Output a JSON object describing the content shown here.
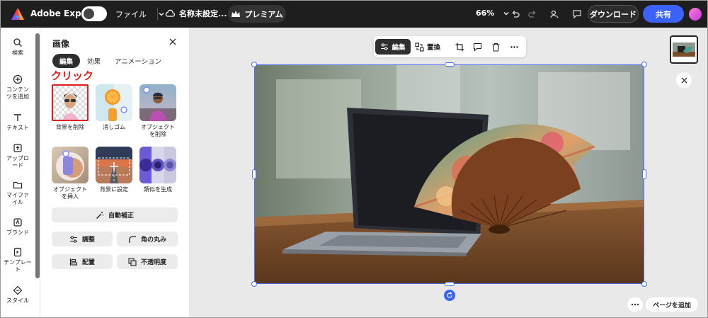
{
  "topbar": {
    "brand": "Adobe Express",
    "file_menu": "ファイル",
    "document_name": "名称未設定...",
    "premium_label": "プレミアム",
    "zoom": "66%",
    "download_label": "ダウンロード",
    "share_label": "共有",
    "avatar_text": "avatar"
  },
  "rail": {
    "items": [
      {
        "label": "検索",
        "icon": "search-icon"
      },
      {
        "label": "コンテンツを追加",
        "icon": "plus-circle-icon"
      },
      {
        "label": "テキスト",
        "icon": "text-icon"
      },
      {
        "label": "アップロード",
        "icon": "upload-icon"
      },
      {
        "label": "マイファイル",
        "icon": "folder-icon"
      },
      {
        "label": "ブランド",
        "icon": "brand-icon"
      },
      {
        "label": "テンプレート",
        "icon": "template-icon"
      },
      {
        "label": "スタイル",
        "icon": "style-icon"
      }
    ]
  },
  "panel": {
    "title": "画像",
    "tabs": [
      "編集",
      "効果",
      "アニメーション"
    ],
    "click_annotation": "クリック",
    "tools": [
      {
        "label": "背景を削除"
      },
      {
        "label": "消しゴム"
      },
      {
        "label": "オブジェクトを削除"
      },
      {
        "label": "オブジェクトを挿入"
      },
      {
        "label": "背景に設定"
      },
      {
        "label": "類似を生成"
      }
    ],
    "auto_enhance": "自動補正",
    "adjust": "調整",
    "round_corners": "角の丸み",
    "arrange": "配置",
    "opacity": "不透明度"
  },
  "canvas": {
    "toolbar": {
      "edit": "編集",
      "replace": "置換"
    },
    "add_page": "ページを追加",
    "accent_color": "#3b63fb"
  }
}
